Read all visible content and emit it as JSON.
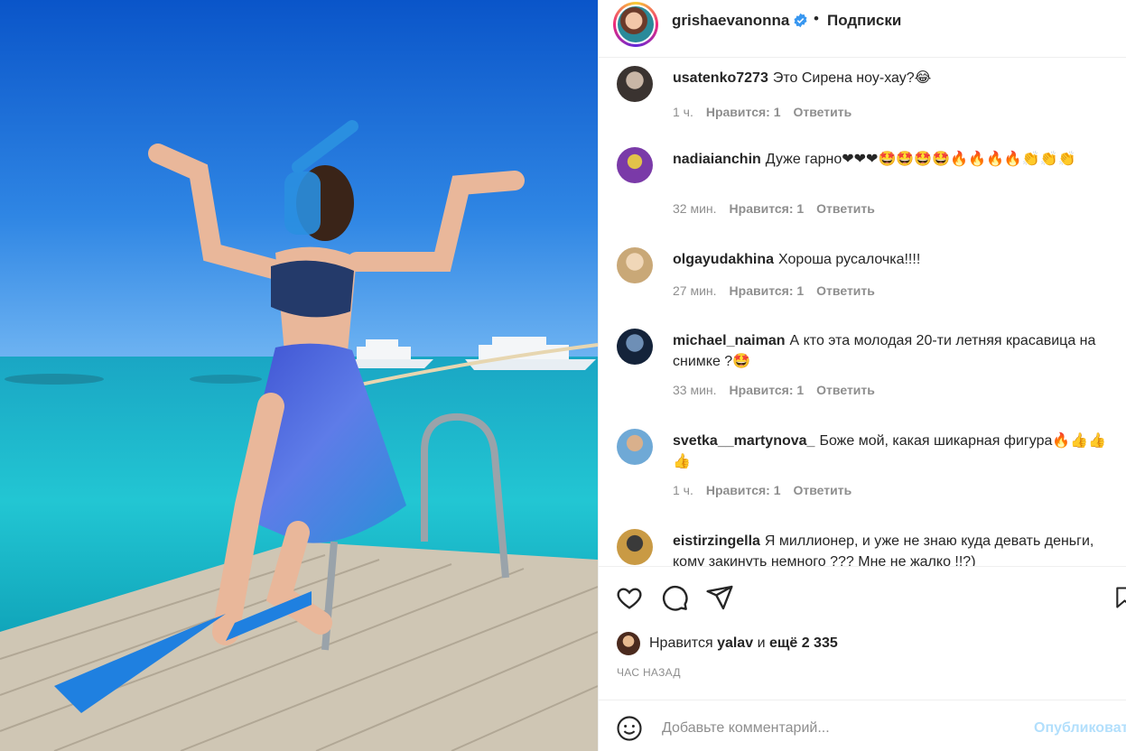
{
  "post": {
    "author": "grishaevanonna",
    "dot": "•",
    "follow_label": "Подписки",
    "verified_icon": "verified-badge-icon"
  },
  "comments": [
    {
      "user": "usatenko7273",
      "text": "Это Сирена ноу-хау?😂",
      "time": "1 ч.",
      "likes": "Нравится: 1",
      "reply": "Ответить"
    },
    {
      "user": "nadiaianchin",
      "text": "Дуже гарно❤❤❤🤩🤩🤩🤩🔥🔥🔥🔥👏👏👏",
      "time": "32 мин.",
      "likes": "Нравится: 1",
      "reply": "Ответить"
    },
    {
      "user": "olgayudakhina",
      "text": "Хороша русалочка!!!!",
      "time": "27 мин.",
      "likes": "Нравится: 1",
      "reply": "Ответить"
    },
    {
      "user": "michael_naiman",
      "text": "А кто эта молодая 20-ти летняя красавица на снимке ?🤩",
      "time": "33 мин.",
      "likes": "Нравится: 1",
      "reply": "Ответить"
    },
    {
      "user": "svetka__martynova_",
      "text": "Боже мой, какая шикарная фигура🔥👍👍👍",
      "time": "1 ч.",
      "likes": "Нравится: 1",
      "reply": "Ответить"
    },
    {
      "user": "eistirzingella",
      "text": "Я миллионер, и уже не знаю куда девать деньги, кому закинуть немного ??? Мне не жалко !!?)",
      "time": "",
      "likes": "",
      "reply": ""
    }
  ],
  "actions": {
    "like_icon": "heart-icon",
    "comment_icon": "comment-icon",
    "share_icon": "share-icon",
    "save_icon": "bookmark-icon"
  },
  "likes": {
    "prefix": "Нравится",
    "user": "yalav",
    "middle": "и",
    "count": "ещё 2 335"
  },
  "time_ago": "ЧАС НАЗАД",
  "add_comment": {
    "placeholder": "Добавьте комментарий...",
    "publish": "Опубликовать"
  },
  "colors": {
    "sky": "#1f6fd6",
    "sea": "#1ec3d0",
    "deck": "#cfc6b4",
    "verified": "#3897f0",
    "publish_disabled": "#b2dffc",
    "meta_gray": "#8e8e8e"
  }
}
